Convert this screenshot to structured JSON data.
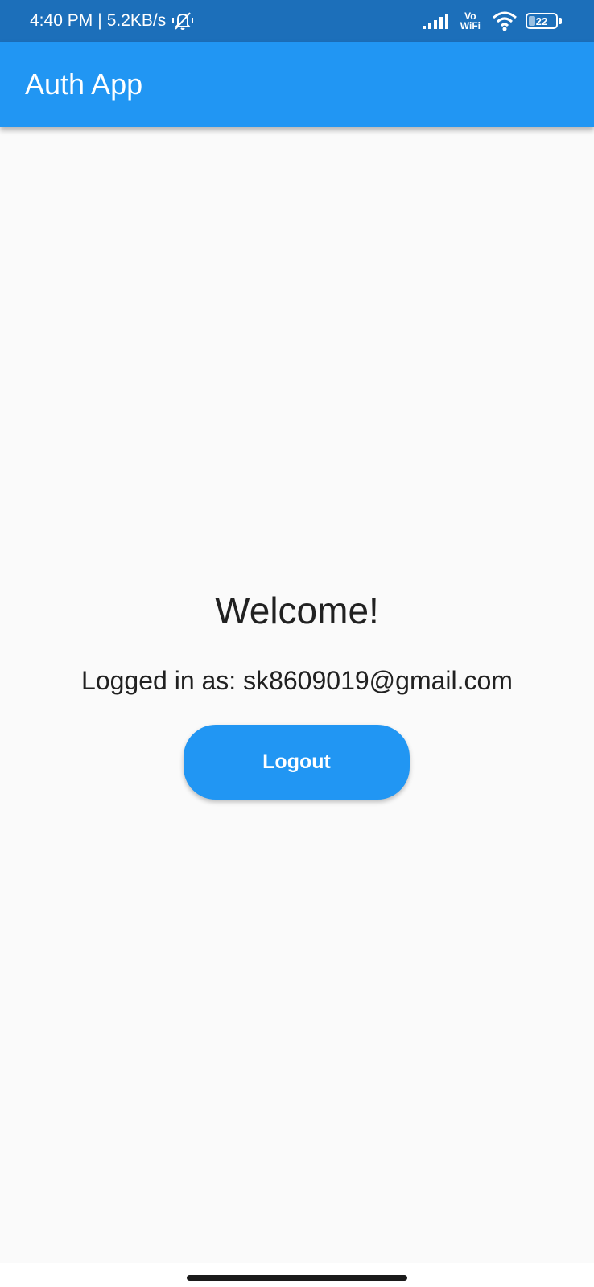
{
  "status_bar": {
    "time": "4:40 PM",
    "separator": "|",
    "network_speed": "5.2KB/s",
    "vowifi_top": "Vo",
    "vowifi_bottom": "WiFi",
    "battery_level": "22",
    "icons": [
      "mute-icon",
      "signal-icon",
      "wifi-icon",
      "battery-icon"
    ]
  },
  "app_bar": {
    "title": "Auth App",
    "color": "#2196f3"
  },
  "main": {
    "welcome": "Welcome!",
    "logged_in_text": "Logged in as: sk8609019@gmail.com",
    "logout_label": "Logout"
  },
  "colors": {
    "status_bar": "#1c6fba",
    "accent": "#2196f3",
    "background": "#fafafa",
    "text": "#212121"
  }
}
